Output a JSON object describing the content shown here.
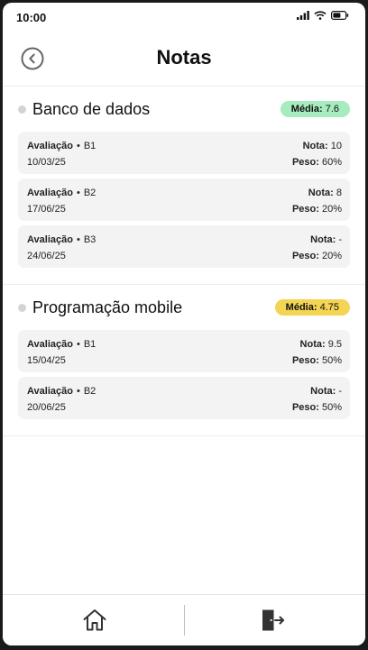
{
  "status_bar": {
    "time": "10:00",
    "icons": [
      "signal-icon",
      "wifi-icon",
      "battery-icon"
    ]
  },
  "header": {
    "title": "Notas",
    "back_icon": "back-arrow-icon"
  },
  "subjects": [
    {
      "name": "Banco de dados",
      "average_label": "Média:",
      "average_value": "7.6",
      "badge_color": "#a6ecbe",
      "evaluations": [
        {
          "label": "Avaliação",
          "separator": "•",
          "code": "B1",
          "date": "10/03/25",
          "grade_label": "Nota:",
          "grade": "10",
          "weight_label": "Peso:",
          "weight": "60%"
        },
        {
          "label": "Avaliação",
          "separator": "•",
          "code": "B2",
          "date": "17/06/25",
          "grade_label": "Nota:",
          "grade": "8",
          "weight_label": "Peso:",
          "weight": "20%"
        },
        {
          "label": "Avaliação",
          "separator": "•",
          "code": "B3",
          "date": "24/06/25",
          "grade_label": "Nota:",
          "grade": "-",
          "weight_label": "Peso:",
          "weight": "20%"
        }
      ]
    },
    {
      "name": "Programação mobile",
      "average_label": "Média:",
      "average_value": "4.75",
      "badge_color": "#f3d453",
      "evaluations": [
        {
          "label": "Avaliação",
          "separator": "•",
          "code": "B1",
          "date": "15/04/25",
          "grade_label": "Nota:",
          "grade": "9.5",
          "weight_label": "Peso:",
          "weight": "50%"
        },
        {
          "label": "Avaliação",
          "separator": "•",
          "code": "B2",
          "date": "20/06/25",
          "grade_label": "Nota:",
          "grade": "-",
          "weight_label": "Peso:",
          "weight": "50%"
        }
      ]
    }
  ],
  "bottom_nav": {
    "items": [
      {
        "icon": "home-icon"
      },
      {
        "icon": "logout-icon"
      }
    ]
  }
}
